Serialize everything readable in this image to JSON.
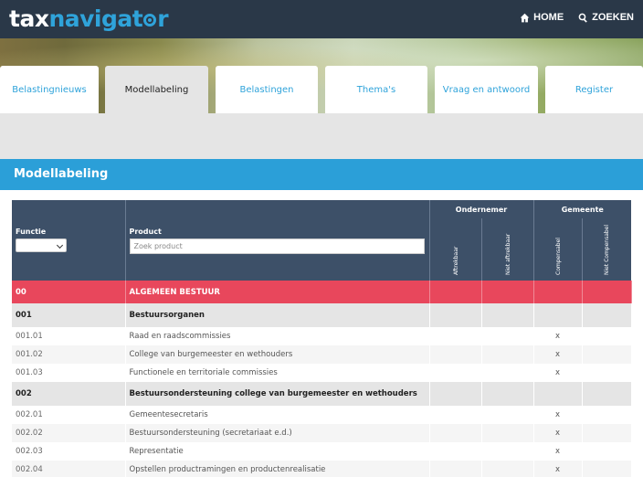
{
  "brand": {
    "tax": "tax",
    "navigat": "navigat",
    "r": "r"
  },
  "topnav": {
    "home": "HOME",
    "search": "ZOEKEN"
  },
  "tabs": [
    "Belastingnieuws",
    "Modellabeling",
    "Belastingen",
    "Thema's",
    "Vraag en antwoord",
    "Register"
  ],
  "active_tab": "Modellabeling",
  "page_title": "Modellabeling",
  "table": {
    "headers": {
      "functie": "Functie",
      "product": "Product",
      "product_placeholder": "Zoek product",
      "group1": "Ondernemer",
      "group2": "Gemeente",
      "col1": "Aftrekbaar",
      "col2": "Niet aftrekbaar",
      "col3": "Compensabel",
      "col4": "Niet Compensabel"
    },
    "rows": [
      {
        "type": "cat",
        "code": "00",
        "product": "ALGEMEEN BESTUUR",
        "marks": [
          "",
          "",
          "",
          ""
        ]
      },
      {
        "type": "sub",
        "code": "001",
        "product": "Bestuursorganen",
        "marks": [
          "",
          "",
          "",
          ""
        ]
      },
      {
        "type": "item",
        "code": "001.01",
        "product": "Raad en raadscommissies",
        "marks": [
          "",
          "",
          "x",
          ""
        ]
      },
      {
        "type": "item",
        "code": "001.02",
        "product": "College van burgemeester en wethouders",
        "marks": [
          "",
          "",
          "x",
          ""
        ]
      },
      {
        "type": "item",
        "code": "001.03",
        "product": "Functionele en territoriale commissies",
        "marks": [
          "",
          "",
          "x",
          ""
        ]
      },
      {
        "type": "sub",
        "code": "002",
        "product": "Bestuursondersteuning college van burgemeester en wethouders",
        "marks": [
          "",
          "",
          "",
          ""
        ]
      },
      {
        "type": "item",
        "code": "002.01",
        "product": "Gemeentesecretaris",
        "marks": [
          "",
          "",
          "x",
          ""
        ]
      },
      {
        "type": "item",
        "code": "002.02",
        "product": "Bestuursondersteuning (secretariaat e.d.)",
        "marks": [
          "",
          "",
          "x",
          ""
        ]
      },
      {
        "type": "item",
        "code": "002.03",
        "product": "Representatie",
        "marks": [
          "",
          "",
          "x",
          ""
        ]
      },
      {
        "type": "item",
        "code": "002.04",
        "product": "Opstellen productramingen en productenrealisatie",
        "marks": [
          "",
          "",
          "x",
          ""
        ]
      }
    ]
  }
}
